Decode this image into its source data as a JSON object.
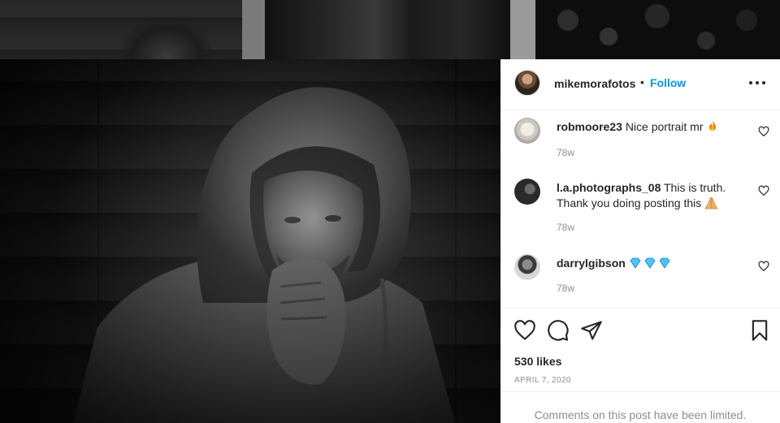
{
  "post": {
    "author": "mikemorafotos",
    "separator": "•",
    "follow_label": "Follow",
    "more_icon": "more-options-icon"
  },
  "comments": [
    {
      "user": "robmoore23",
      "text": "Nice portrait mr",
      "emoji": "fire",
      "time": "78w"
    },
    {
      "user": "l.a.photographs_08",
      "text": "This is truth. Thank you doing posting this",
      "emoji": "folded-hands",
      "time": "78w"
    },
    {
      "user": "darrylgibson",
      "text": "",
      "emoji": "gem-stone x3",
      "time": "78w"
    }
  ],
  "actions": {
    "like_icon": "heart-icon",
    "comment_icon": "comment-icon",
    "share_icon": "share-icon",
    "save_icon": "bookmark-icon"
  },
  "likes": "530 likes",
  "date": "APRIL 7, 2020",
  "limited_notice": "Comments on this post have been limited."
}
